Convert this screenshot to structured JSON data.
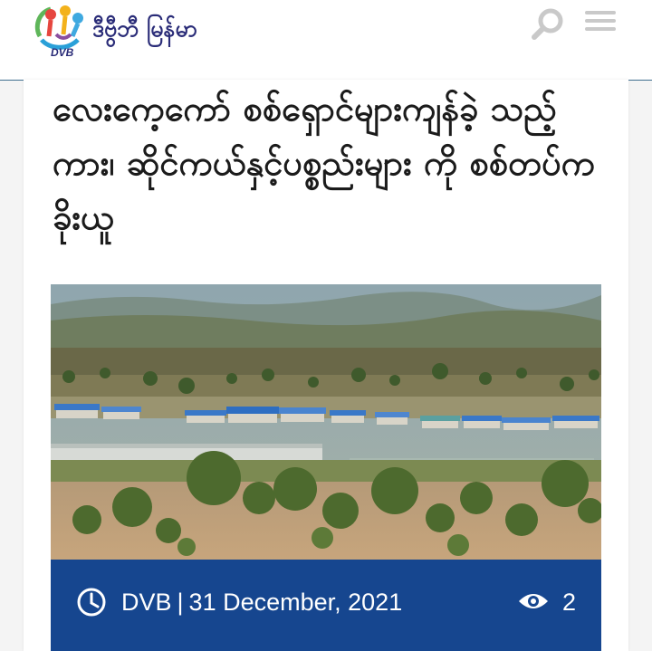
{
  "header": {
    "site_name": "ဒီဗွီဘီ မြန်မာ",
    "logo_caption": "DVB",
    "search_icon": "search-icon",
    "menu_icon": "hamburger-menu-icon"
  },
  "article": {
    "title": "လေးကေ့ကော် စစ်ရှောင်များကျန်ခဲ့ သည့် ကား၊ ဆိုင်ကယ်နှင့်ပစ္စည်းများ ကို စစ်တပ်က ခိုးယူ",
    "image_description_icon": "article-photo",
    "source": "DVB",
    "separator": "|",
    "date": "31 December, 2021",
    "views": "2"
  },
  "colors": {
    "meta_bar": "#16468f",
    "header_divider": "#3f6f8f",
    "logo_text": "#2a2c78",
    "title_text": "#1b1b1b"
  }
}
